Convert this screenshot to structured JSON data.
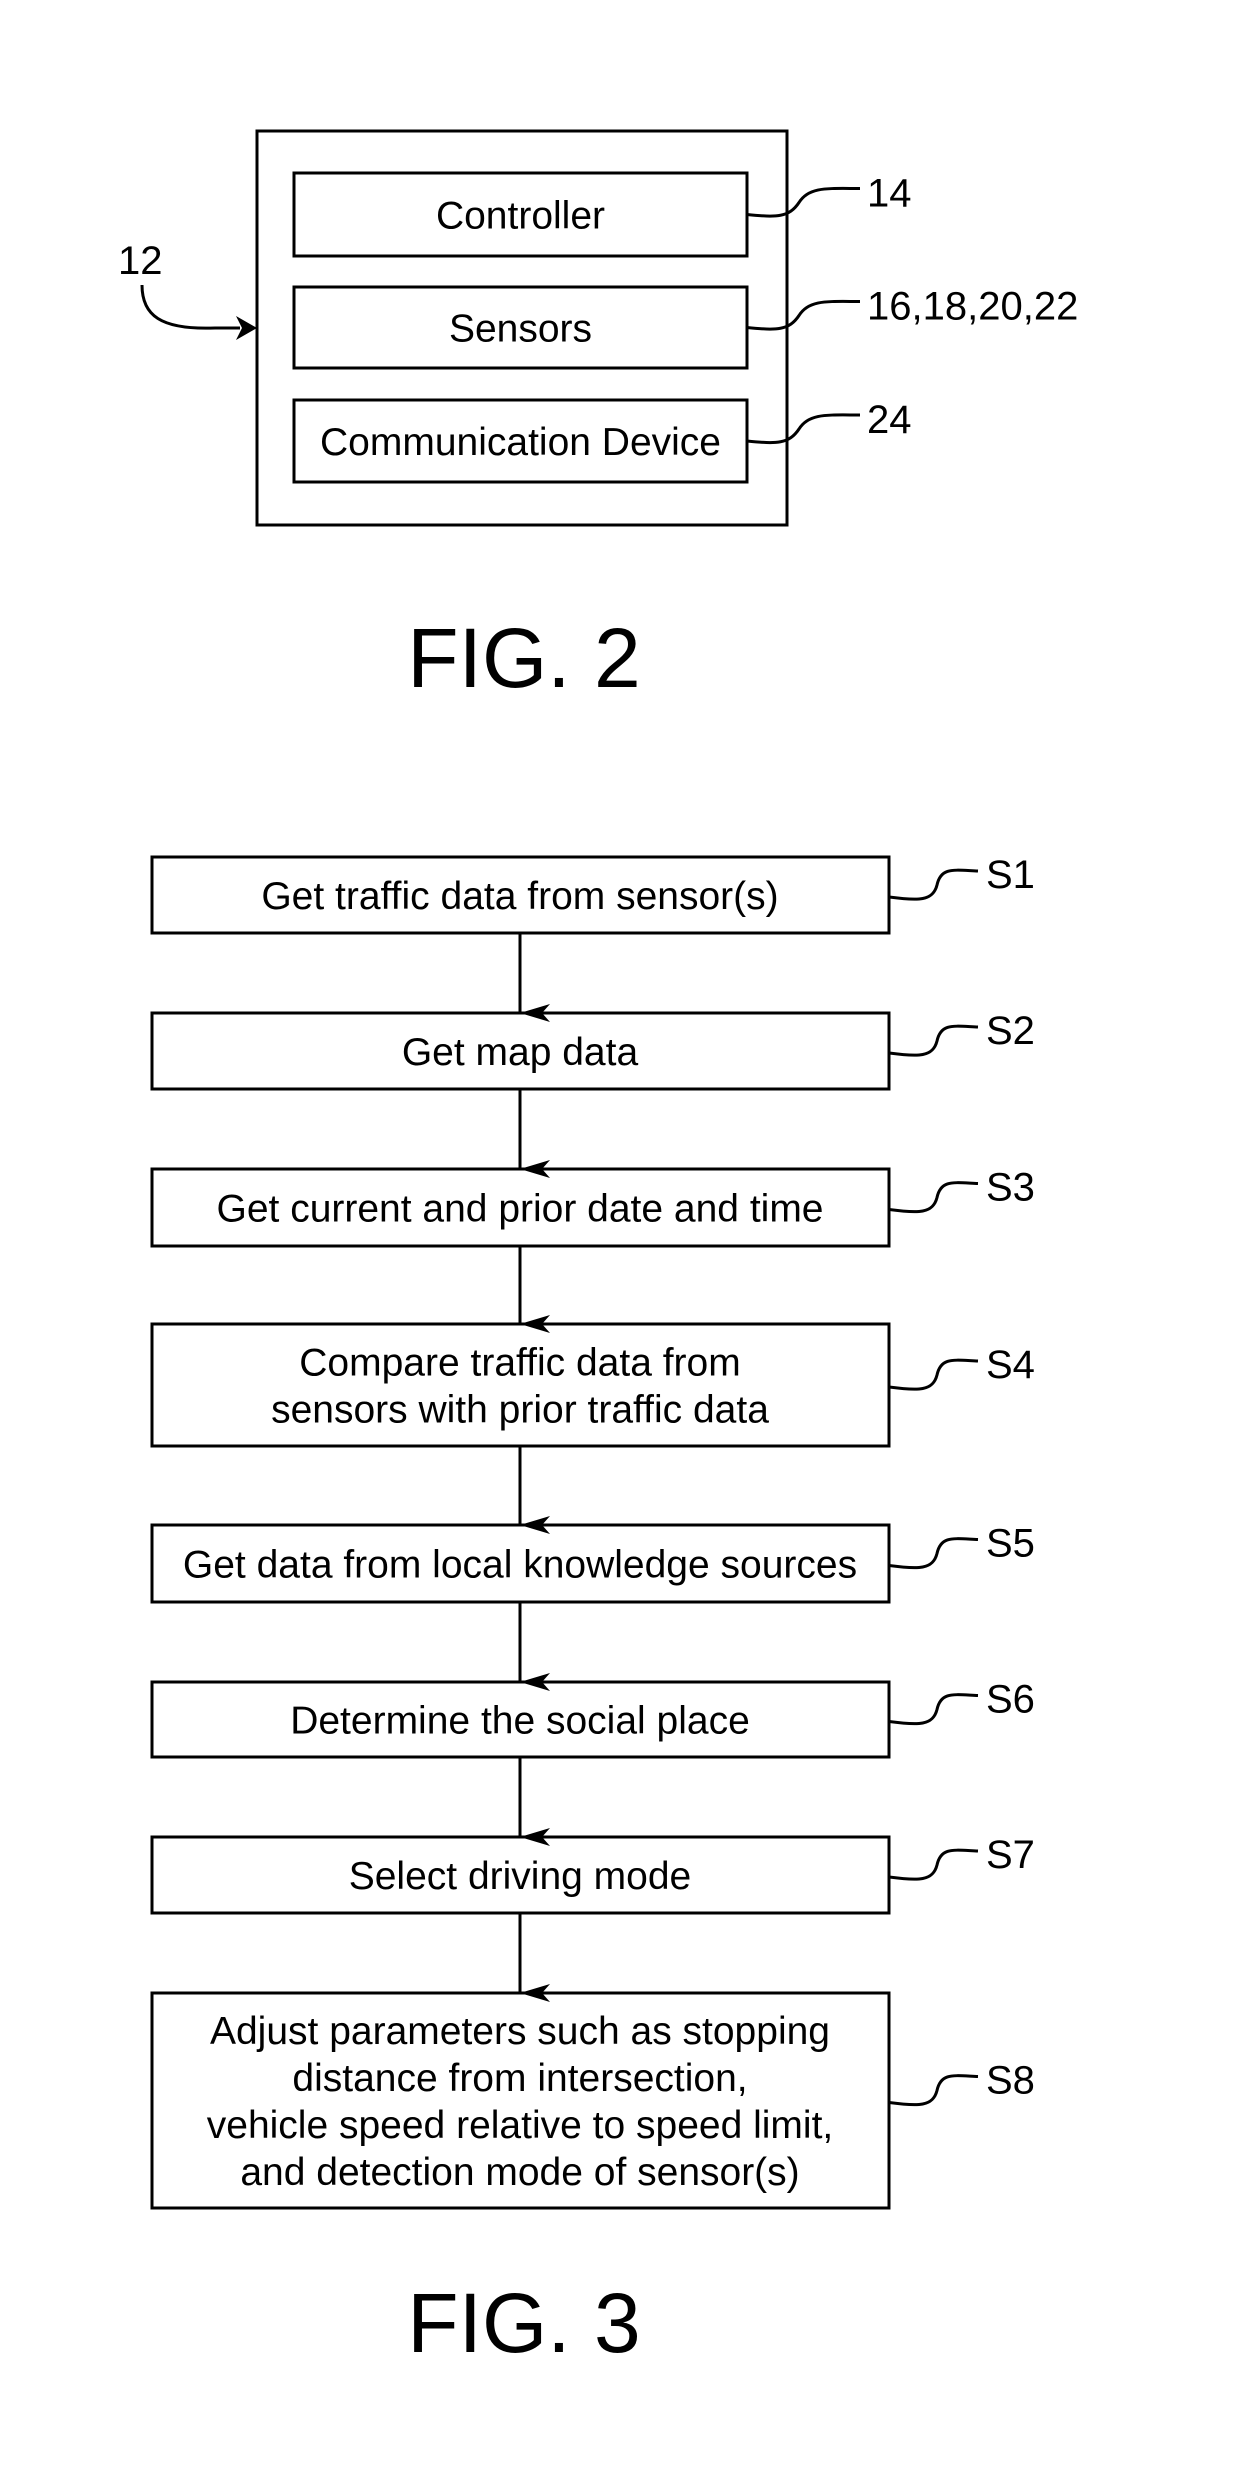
{
  "figure2": {
    "caption": "FIG. 2",
    "system_ref": "12",
    "components": [
      {
        "label": "Controller",
        "ref": "14"
      },
      {
        "label": "Sensors",
        "ref": "16,18,20,22"
      },
      {
        "label": "Communication Device",
        "ref": "24"
      }
    ]
  },
  "figure3": {
    "caption": "FIG. 3",
    "steps": [
      {
        "id": "S1",
        "lines": [
          "Get traffic data from sensor(s)"
        ]
      },
      {
        "id": "S2",
        "lines": [
          "Get map data"
        ]
      },
      {
        "id": "S3",
        "lines": [
          "Get current and prior date and time"
        ]
      },
      {
        "id": "S4",
        "lines": [
          "Compare traffic data from",
          "sensors with prior traffic data"
        ]
      },
      {
        "id": "S5",
        "lines": [
          "Get data from local knowledge sources"
        ]
      },
      {
        "id": "S6",
        "lines": [
          "Determine the social place"
        ]
      },
      {
        "id": "S7",
        "lines": [
          "Select driving mode"
        ]
      },
      {
        "id": "S8",
        "lines": [
          "Adjust parameters such as stopping",
          "distance from intersection,",
          "vehicle speed relative to speed limit,",
          "and detection mode of sensor(s)"
        ]
      }
    ],
    "flow": [
      [
        "S1",
        "S2"
      ],
      [
        "S2",
        "S3"
      ],
      [
        "S3",
        "S4"
      ],
      [
        "S4",
        "S5"
      ],
      [
        "S5",
        "S6"
      ],
      [
        "S6",
        "S7"
      ],
      [
        "S7",
        "S8"
      ]
    ]
  }
}
